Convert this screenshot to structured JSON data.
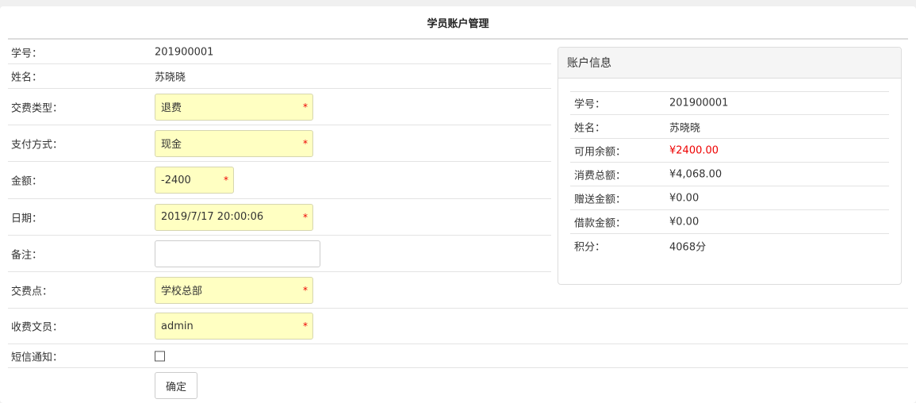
{
  "title": "学员账户管理",
  "form": {
    "student_id": {
      "label": "学号：",
      "value": "201900001"
    },
    "name": {
      "label": "姓名：",
      "value": "苏晓晓"
    },
    "fee_type": {
      "label": "交费类型：",
      "value": "退费"
    },
    "pay_method": {
      "label": "支付方式：",
      "value": "现金"
    },
    "amount": {
      "label": "金额：",
      "value": "-2400"
    },
    "date": {
      "label": "日期：",
      "value": "2019/7/17 20:00:06"
    },
    "remark": {
      "label": "备注：",
      "value": ""
    },
    "pay_point": {
      "label": "交费点：",
      "value": "学校总部"
    },
    "cashier": {
      "label": "收费文员：",
      "value": "admin"
    },
    "sms": {
      "label": "短信通知：",
      "checked": false
    },
    "submit_label": "确定",
    "required_mark": "*"
  },
  "account": {
    "header": "账户信息",
    "rows": [
      {
        "label": "学号：",
        "value": "201900001"
      },
      {
        "label": "姓名：",
        "value": "苏晓晓"
      },
      {
        "label": "可用余额：",
        "value": "¥2400.00",
        "highlight": "#e00000"
      },
      {
        "label": "消费总额：",
        "value": "¥4,068.00"
      },
      {
        "label": "赠送金额：",
        "value": "¥0.00"
      },
      {
        "label": "借款金额：",
        "value": "¥0.00"
      },
      {
        "label": "积分：",
        "value": "4068分"
      }
    ]
  }
}
